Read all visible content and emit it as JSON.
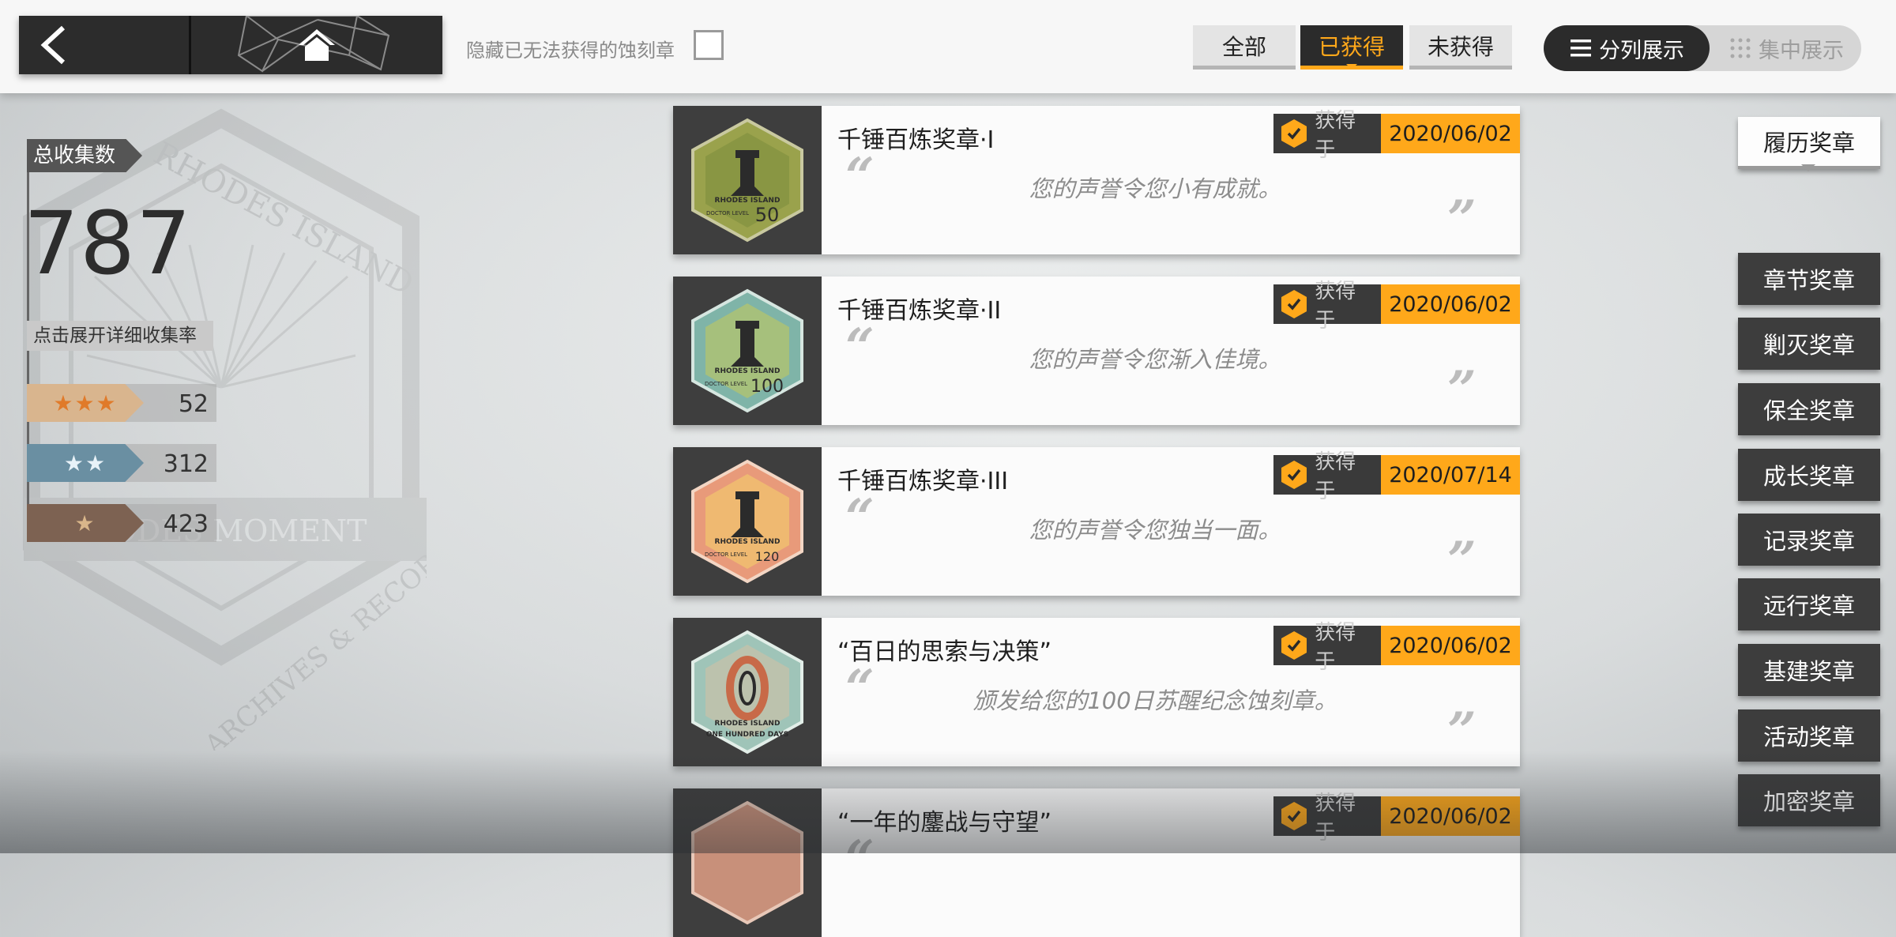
{
  "header": {
    "hide_unobtainable_label": "隐藏已无法获得的蚀刻章",
    "hide_unobtainable_checked": false,
    "filter_tabs": [
      {
        "label": "全部",
        "active": false
      },
      {
        "label": "已获得",
        "active": true
      },
      {
        "label": "未获得",
        "active": false
      }
    ],
    "view_modes": [
      {
        "label": "分列展示",
        "active": true
      },
      {
        "label": "集中展示",
        "active": false
      }
    ]
  },
  "stats": {
    "total_label": "总收集数",
    "total_count": "787",
    "detail_label": "点击展开详细收集率",
    "rarity": [
      {
        "stars": "★★★",
        "count": "52",
        "color": "#e8a060"
      },
      {
        "stars": "★★",
        "count": "312",
        "color": "#5d8fa8"
      },
      {
        "stars": "★",
        "count": "423",
        "color": "#8a6a55"
      }
    ]
  },
  "medals": [
    {
      "title": "千锤百炼奖章·I",
      "acquired_label": "获得于",
      "date": "2020/06/02",
      "desc": "您的声誉令您小有成就。",
      "level_text": "50"
    },
    {
      "title": "千锤百炼奖章·II",
      "acquired_label": "获得于",
      "date": "2020/06/02",
      "desc": "您的声誉令您渐入佳境。",
      "level_text": "100"
    },
    {
      "title": "千锤百炼奖章·III",
      "acquired_label": "获得于",
      "date": "2020/07/14",
      "desc": "您的声誉令您独当一面。",
      "level_text": "120"
    },
    {
      "title": "“百日的思索与决策”",
      "acquired_label": "获得于",
      "date": "2020/06/02",
      "desc": "颁发给您的100日苏醒纪念蚀刻章。",
      "level_text": "ONE HUNDRED DAYS"
    },
    {
      "title": "“一年的鏖战与守望”",
      "acquired_label": "获得于",
      "date": "2020/06/02",
      "desc": "",
      "level_text": ""
    }
  ],
  "medal_art": {
    "rhodes": "RHODES ISLAND",
    "doctor_level": "DOCTOR LEVEL"
  },
  "categories": [
    {
      "label": "履历奖章",
      "active": true
    },
    {
      "label": "章节奖章",
      "active": false
    },
    {
      "label": "剿灭奖章",
      "active": false
    },
    {
      "label": "保全奖章",
      "active": false
    },
    {
      "label": "成长奖章",
      "active": false
    },
    {
      "label": "记录奖章",
      "active": false
    },
    {
      "label": "远行奖章",
      "active": false
    },
    {
      "label": "基建奖章",
      "active": false
    },
    {
      "label": "活动奖章",
      "active": false
    },
    {
      "label": "加密奖章",
      "active": false
    }
  ],
  "watermark": {
    "text_top": "RHODES ISLAND",
    "text_mid": "RHODES MOMENT",
    "text_bottom": "ARCHIVES & RECORDS"
  }
}
